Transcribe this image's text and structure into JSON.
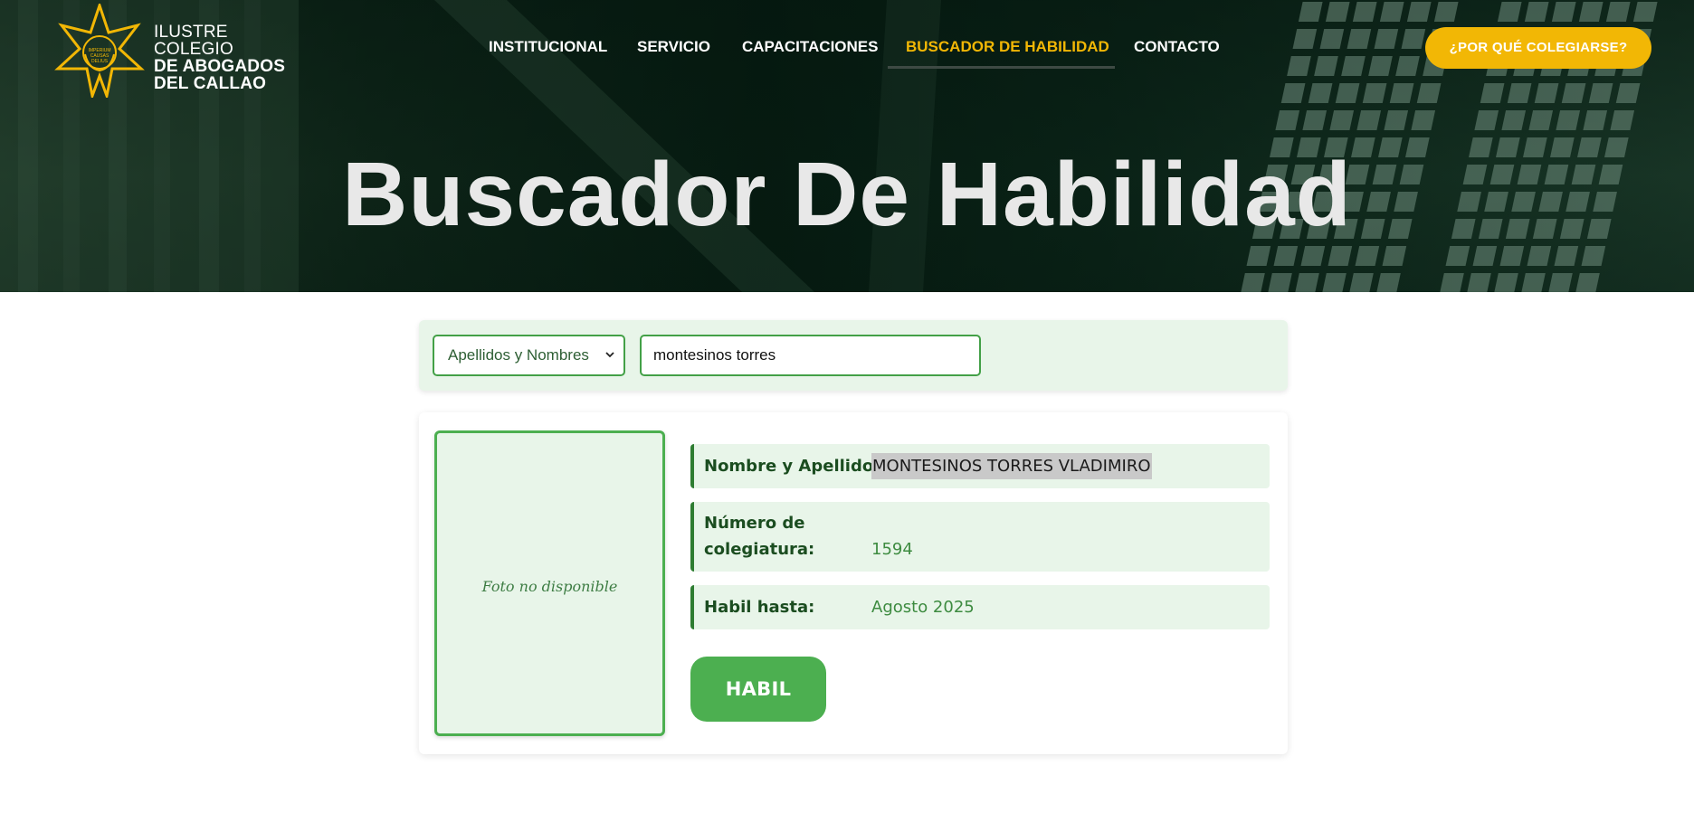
{
  "header": {
    "logo": {
      "line1": "ILUSTRE COLEGIO",
      "line2": "DE ABOGADOS",
      "line3": "DEL CALLAO",
      "seal_text": "IMPERIUM CAUSAS DELIUS",
      "icon": "star-seal-icon"
    },
    "nav": [
      {
        "label": "INSTITUCIONAL",
        "active": false
      },
      {
        "label": "SERVICIO",
        "active": false
      },
      {
        "label": "CAPACITACIONES",
        "active": false
      },
      {
        "label": "BUSCADOR DE HABILIDAD",
        "active": true
      },
      {
        "label": "CONTACTO",
        "active": false
      }
    ],
    "cta_label": "¿POR QUÉ COLEGIARSE?"
  },
  "hero": {
    "title": "Buscador De Habilidad"
  },
  "search": {
    "type_selected": "Apellidos y Nombres",
    "query_value": "montesinos torres"
  },
  "result": {
    "photo_placeholder": "Foto no disponible",
    "name_label": "Nombre y Apellidos:",
    "name_value": "MONTESINOS TORRES VLADIMIRO",
    "number_label_1": "Número de",
    "number_label_2": "colegiatura:",
    "number_value": "1594",
    "valid_label": "Habil hasta:",
    "valid_value": "Agosto 2025",
    "status_label": "HABIL"
  },
  "colors": {
    "accent": "#f2b705",
    "primary_green": "#4caf50",
    "dark_green": "#2e7d32",
    "panel_bg": "#e8f5e9"
  }
}
